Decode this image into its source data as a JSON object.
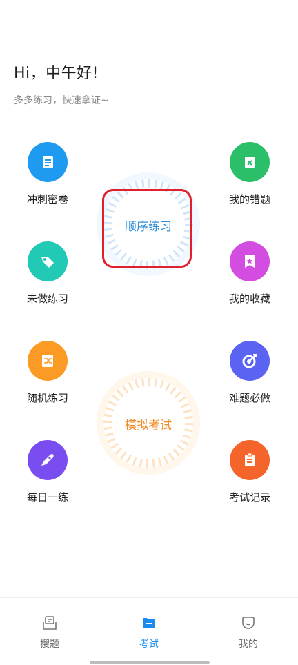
{
  "header": {
    "greeting": "Hi，中午好!",
    "subtitle": "多多练习，快速拿证~"
  },
  "tiles": [
    {
      "label": "冲刺密卷",
      "icon": "document-icon",
      "color": "#1e9bf0"
    },
    {
      "label": "我的错题",
      "icon": "wrong-question-icon",
      "color": "#2bbf6a"
    },
    {
      "label": "未做练习",
      "icon": "tag-icon",
      "color": "#22c9b4"
    },
    {
      "label": "我的收藏",
      "icon": "bookmark-star-icon",
      "color": "#d24de0"
    },
    {
      "label": "随机练习",
      "icon": "shuffle-icon",
      "color": "#fb9a25"
    },
    {
      "label": "难题必做",
      "icon": "target-icon",
      "color": "#5b63f2"
    },
    {
      "label": "每日一练",
      "icon": "rocket-icon",
      "color": "#7a4df0"
    },
    {
      "label": "考试记录",
      "icon": "clipboard-icon",
      "color": "#f5642a"
    }
  ],
  "rings": {
    "sequential_practice": "顺序练习",
    "mock_exam": "模拟考试"
  },
  "tabbar": {
    "items": [
      {
        "label": "搜题",
        "icon": "search-question-icon",
        "active": false
      },
      {
        "label": "考试",
        "icon": "folder-minus-icon",
        "active": true
      },
      {
        "label": "我的",
        "icon": "profile-face-icon",
        "active": false
      }
    ]
  },
  "colors": {
    "accent_blue": "#1a8cf0",
    "highlight_red": "#e0202f",
    "ring_blue_text": "#2f8fd8",
    "ring_orange_text": "#f08a24"
  }
}
